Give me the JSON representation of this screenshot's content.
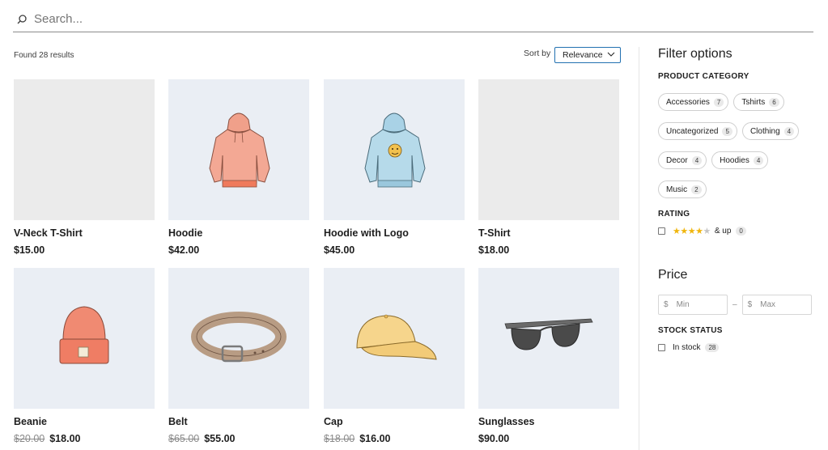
{
  "search": {
    "placeholder": "Search..."
  },
  "results": {
    "found_text": "Found 28 results"
  },
  "sort": {
    "label": "Sort by",
    "selected": "Relevance"
  },
  "products": [
    {
      "name": "V-Neck T-Shirt",
      "price": "$15.00",
      "old_price": "",
      "image": "none"
    },
    {
      "name": "Hoodie",
      "price": "$42.00",
      "old_price": "",
      "image": "hoodie-icon"
    },
    {
      "name": "Hoodie with Logo",
      "price": "$45.00",
      "old_price": "",
      "image": "hoodie-with-logo-icon"
    },
    {
      "name": "T-Shirt",
      "price": "$18.00",
      "old_price": "",
      "image": "none"
    },
    {
      "name": "Beanie",
      "price": "$18.00",
      "old_price": "$20.00",
      "image": "beanie-icon"
    },
    {
      "name": "Belt",
      "price": "$55.00",
      "old_price": "$65.00",
      "image": "belt-icon"
    },
    {
      "name": "Cap",
      "price": "$16.00",
      "old_price": "$18.00",
      "image": "cap-icon"
    },
    {
      "name": "Sunglasses",
      "price": "$90.00",
      "old_price": "",
      "image": "sunglasses-icon"
    }
  ],
  "filters": {
    "title": "Filter options",
    "category_title": "PRODUCT CATEGORY",
    "categories": [
      {
        "label": "Accessories",
        "count": "7"
      },
      {
        "label": "Tshirts",
        "count": "6"
      },
      {
        "label": "Uncategorized",
        "count": "5"
      },
      {
        "label": "Clothing",
        "count": "4"
      },
      {
        "label": "Decor",
        "count": "4"
      },
      {
        "label": "Hoodies",
        "count": "4"
      },
      {
        "label": "Music",
        "count": "2"
      }
    ],
    "rating_title": "RATING",
    "rating": {
      "stars": 4,
      "suffix": "& up",
      "count": "0"
    },
    "price_title": "Price",
    "price_min": {
      "currency": "$",
      "placeholder": "Min"
    },
    "price_max": {
      "currency": "$",
      "placeholder": "Max"
    },
    "price_separator": "–",
    "stock_title": "STOCK STATUS",
    "stock": {
      "label": "In stock",
      "count": "28"
    }
  },
  "colors": {
    "accent": "#2271b1",
    "star": "#f0b60e",
    "thumb_bg": "#eaeef4"
  }
}
